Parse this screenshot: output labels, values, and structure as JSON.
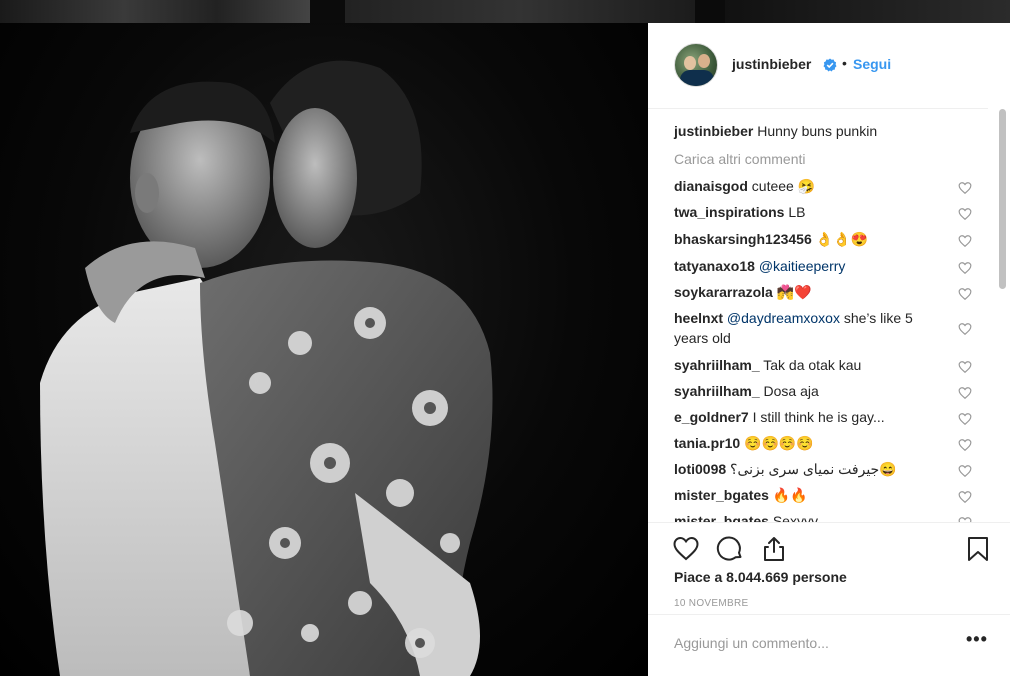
{
  "post": {
    "username": "justinbieber",
    "follow_label": "Segui",
    "separator": "•",
    "verified_icon": "verified-badge-icon"
  },
  "caption": {
    "username": "justinbieber",
    "text": "Hunny buns punkin"
  },
  "load_more_label": "Carica altri commenti",
  "comments": [
    {
      "user": "dianaisgod",
      "text": "cuteee 🤧"
    },
    {
      "user": "twa_inspirations",
      "text": "LB"
    },
    {
      "user": "bhaskarsingh123456",
      "text": "👌👌😍"
    },
    {
      "user": "tatyanaxo18",
      "mention": "@kaitieeperry",
      "text": ""
    },
    {
      "user": "soykararrazola",
      "text": "💏❤️"
    },
    {
      "user": "heelnxt",
      "mention": "@daydreamxoxox",
      "text": "she’s like 5",
      "text2": "years old"
    },
    {
      "user": "syahriilham_",
      "text": "Tak da otak kau"
    },
    {
      "user": "syahriilham_",
      "text": "Dosa aja"
    },
    {
      "user": "e_goldner7",
      "text": "I still think he is gay..."
    },
    {
      "user": "tania.pr10",
      "text": "☺️☺️☺️☺️"
    },
    {
      "user": "loti0098",
      "text": "جیرفت نمیای سری بزنی؟😄"
    },
    {
      "user": "mister_bgates",
      "text": "🔥🔥"
    },
    {
      "user": "mister_bgates",
      "text": "Sexyyy"
    }
  ],
  "likes": {
    "text": "Piace a 8.044.669 persone"
  },
  "date": "10 NOVEMBRE",
  "add_comment": {
    "placeholder": "Aggiungi un commento..."
  },
  "more_label": "•••",
  "icons": {
    "like": "heart-icon",
    "comment": "comment-icon",
    "share": "share-icon",
    "save": "bookmark-icon"
  }
}
